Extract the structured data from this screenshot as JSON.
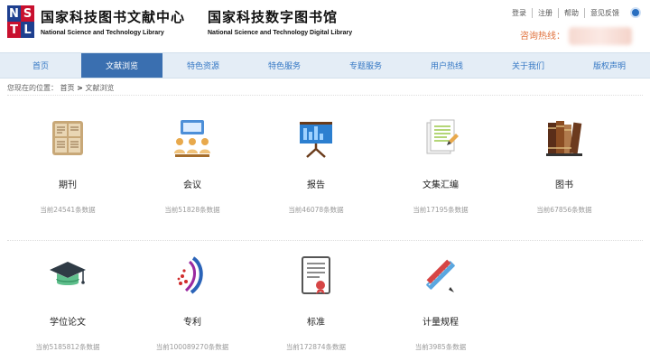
{
  "header": {
    "logo_letters": [
      "N",
      "S",
      "T",
      "L"
    ],
    "org1": {
      "cn": "国家科技图书文献中心",
      "en": "National Science and Technology Library"
    },
    "org2": {
      "cn": "国家科技数字图书馆",
      "en": "National Science and Technology Digital Library"
    },
    "links": [
      "登录",
      "注册",
      "帮助",
      "意见反馈"
    ],
    "hotline_label": "咨询热线：",
    "globe_icon": "globe-icon"
  },
  "nav": {
    "items": [
      "首页",
      "文献浏览",
      "特色资源",
      "特色服务",
      "专题服务",
      "用户热线",
      "关于我们",
      "版权声明"
    ],
    "active_index": 1
  },
  "breadcrumb": {
    "prefix": "您现在的位置：",
    "home": "首页",
    "separator": ">",
    "current": "文献浏览"
  },
  "categories": [
    {
      "icon": "journal-icon",
      "title": "期刊",
      "count": "当前24541条数据"
    },
    {
      "icon": "conference-icon",
      "title": "会议",
      "count": "当前51828条数据"
    },
    {
      "icon": "report-icon",
      "title": "报告",
      "count": "当前46078条数据"
    },
    {
      "icon": "collection-icon",
      "title": "文集汇编",
      "count": "当前17195条数据"
    },
    {
      "icon": "books-icon",
      "title": "图书",
      "count": "当前67856条数据"
    },
    {
      "icon": "graduation-cap-icon",
      "title": "学位论文",
      "count": "当前5185812条数据"
    },
    {
      "icon": "patent-icon",
      "title": "专利",
      "count": "当前100089270条数据"
    },
    {
      "icon": "standard-icon",
      "title": "标准",
      "count": "当前172874条数据"
    },
    {
      "icon": "metrology-icon",
      "title": "计量规程",
      "count": "当前3985条数据"
    }
  ]
}
